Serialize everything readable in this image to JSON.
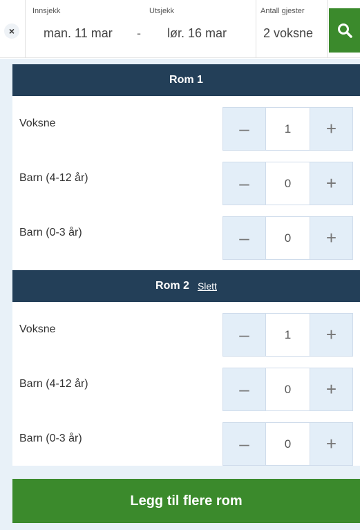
{
  "header": {
    "close_icon": "close-icon",
    "checkin": {
      "label": "Innsjekk",
      "value": "man. 11 mar"
    },
    "separator": "-",
    "checkout": {
      "label": "Utsjekk",
      "value": "lør. 16 mar"
    },
    "guests": {
      "label": "Antall gjester",
      "value": "2 voksne"
    },
    "search_icon": "search-icon",
    "accent": "#3b8a2c"
  },
  "rooms": [
    {
      "title": "Rom 1",
      "rows": [
        {
          "label": "Voksne",
          "value": "1",
          "minus": "–",
          "plus": "+"
        },
        {
          "label": "Barn (4-12 år)",
          "value": "0",
          "minus": "–",
          "plus": "+"
        },
        {
          "label": "Barn (0-3 år)",
          "value": "0",
          "minus": "–",
          "plus": "+"
        }
      ]
    },
    {
      "title": "Rom 2",
      "delete_label": "Slett",
      "rows": [
        {
          "label": "Voksne",
          "value": "1",
          "minus": "–",
          "plus": "+"
        },
        {
          "label": "Barn (4-12 år)",
          "value": "0",
          "minus": "–",
          "plus": "+"
        },
        {
          "label": "Barn (0-3 år)",
          "value": "0",
          "minus": "–",
          "plus": "+"
        }
      ]
    }
  ],
  "add_room_label": "Legg til flere rom",
  "colors": {
    "header_bg": "#233f58",
    "panel_bg": "#e8f1f8",
    "stepper_bg": "#e3eef8",
    "button_green": "#3b8a2c"
  }
}
